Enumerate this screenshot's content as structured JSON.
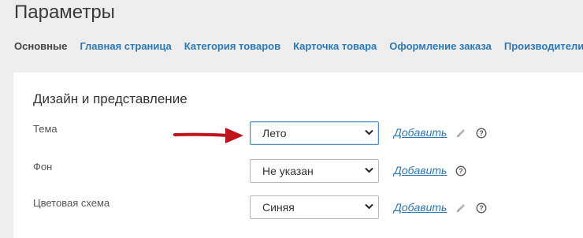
{
  "page": {
    "title": "Параметры"
  },
  "tabs": [
    {
      "label": "Основные",
      "active": true
    },
    {
      "label": "Главная страница",
      "active": false
    },
    {
      "label": "Категория товаров",
      "active": false
    },
    {
      "label": "Карточка товара",
      "active": false
    },
    {
      "label": "Оформление заказа",
      "active": false
    },
    {
      "label": "Производители",
      "active": false
    }
  ],
  "section": {
    "title": "Дизайн и представление",
    "rows": [
      {
        "label": "Тема",
        "selected": "Лето",
        "add_label": "Добавить",
        "has_edit_icon": true
      },
      {
        "label": "Фон",
        "selected": "Не указан",
        "add_label": "Добавить",
        "has_edit_icon": false
      },
      {
        "label": "Цветовая схема",
        "selected": "Синяя",
        "add_label": "Добавить",
        "has_edit_icon": true
      }
    ]
  },
  "colors": {
    "link": "#2e79b5",
    "arrow": "#c0141c",
    "background": "#ededed"
  }
}
